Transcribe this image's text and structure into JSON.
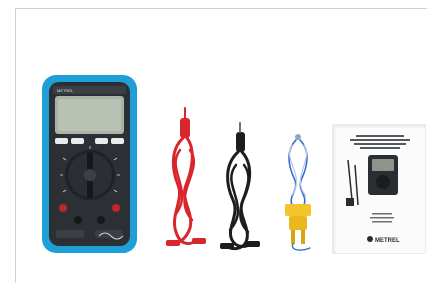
{
  "image": {
    "description_items": [
      "digital-multimeter",
      "red-test-lead",
      "black-test-lead",
      "thermocouple-probe",
      "user-manual"
    ]
  },
  "manual": {
    "brand": "METREL"
  },
  "multimeter": {
    "brand_label": "METREL"
  }
}
